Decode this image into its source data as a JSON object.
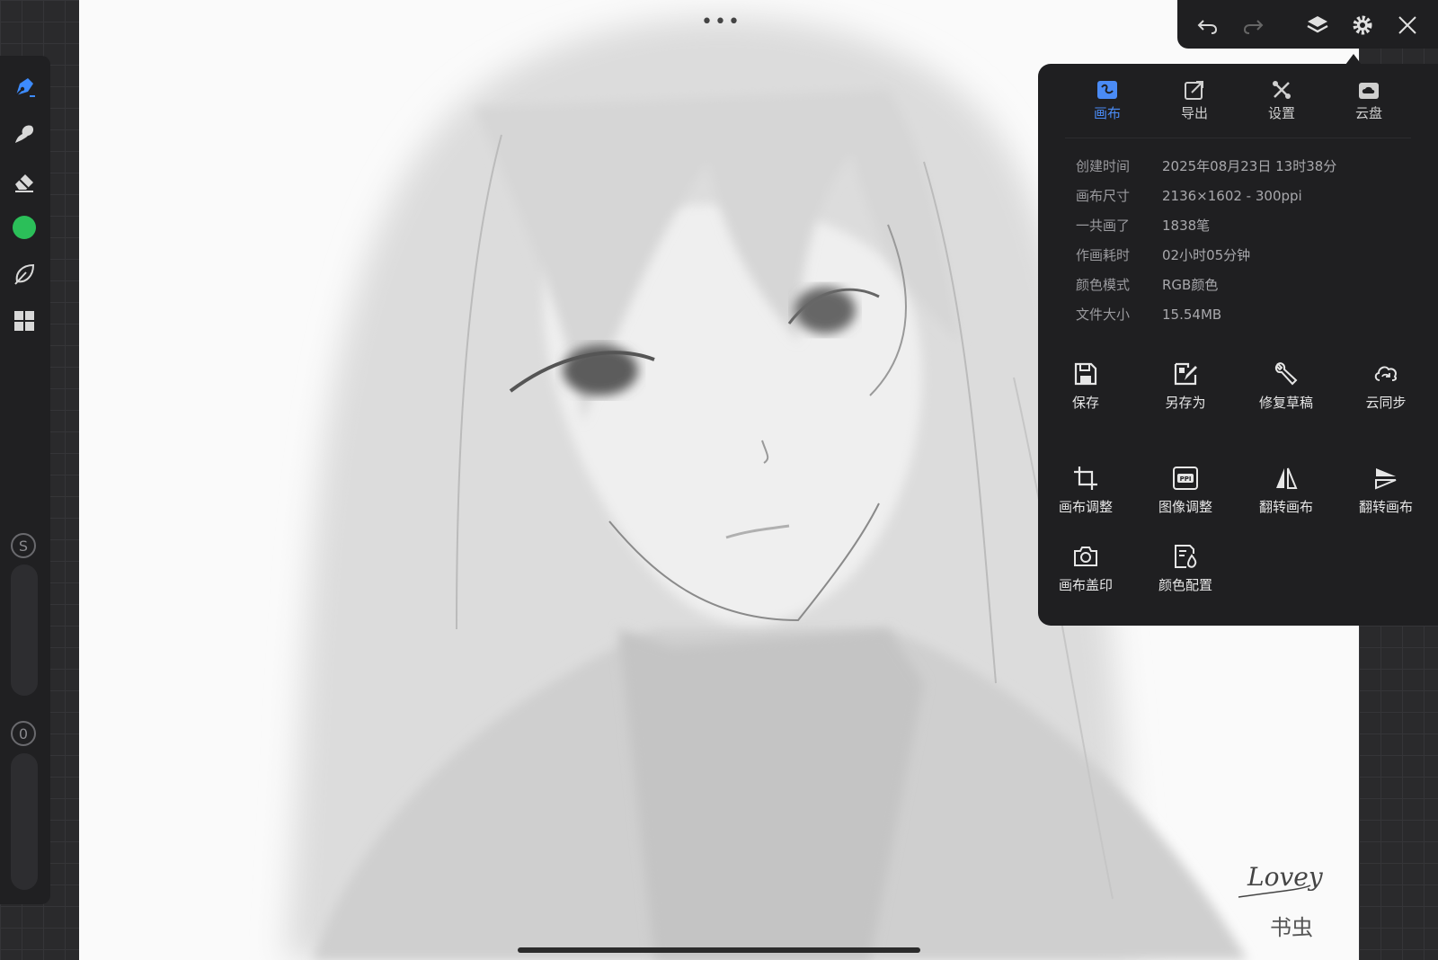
{
  "canvas": {
    "more_label": "•••",
    "signature": {
      "line1": "Lovey",
      "line2": "书虫"
    }
  },
  "left_toolbar": {
    "tools": [
      {
        "name": "pen-icon"
      },
      {
        "name": "smudge-icon"
      },
      {
        "name": "eraser-icon"
      },
      {
        "name": "color-swatch",
        "color": "#2bbf59"
      },
      {
        "name": "leaf-icon"
      },
      {
        "name": "grid-icon"
      }
    ],
    "size_badge": "S",
    "opacity_badge": "0"
  },
  "top_toolbar": {
    "items": [
      "undo-icon",
      "redo-icon",
      "layers-icon",
      "gear-icon",
      "close-icon"
    ]
  },
  "panel": {
    "tabs": [
      {
        "label": "画布",
        "icon": "canvas-icon",
        "active": true
      },
      {
        "label": "导出",
        "icon": "export-icon",
        "active": false
      },
      {
        "label": "设置",
        "icon": "settings-icon",
        "active": false
      },
      {
        "label": "云盘",
        "icon": "cloud-drive-icon",
        "active": false
      }
    ],
    "info": [
      {
        "key": "创建时间",
        "value": "2025年08月23日 13时38分"
      },
      {
        "key": "画布尺寸",
        "value": "2136×1602 - 300ppi"
      },
      {
        "key": "一共画了",
        "value": "1838笔"
      },
      {
        "key": "作画耗时",
        "value": "02小时05分钟"
      },
      {
        "key": "颜色模式",
        "value": "RGB颜色"
      },
      {
        "key": "文件大小",
        "value": "15.54MB"
      }
    ],
    "actions": [
      {
        "label": "保存",
        "icon": "save-icon"
      },
      {
        "label": "另存为",
        "icon": "save-as-icon"
      },
      {
        "label": "修复草稿",
        "icon": "repair-icon"
      },
      {
        "label": "云同步",
        "icon": "cloud-sync-icon"
      },
      {
        "label": "画布调整",
        "icon": "crop-icon"
      },
      {
        "label": "图像调整",
        "icon": "ppi-icon"
      },
      {
        "label": "翻转画布",
        "icon": "flip-horizontal-icon"
      },
      {
        "label": "翻转画布",
        "icon": "flip-vertical-icon"
      },
      {
        "label": "画布盖印",
        "icon": "camera-icon"
      },
      {
        "label": "颜色配置",
        "icon": "color-profile-icon"
      }
    ],
    "accent": "#4a8bf5"
  }
}
